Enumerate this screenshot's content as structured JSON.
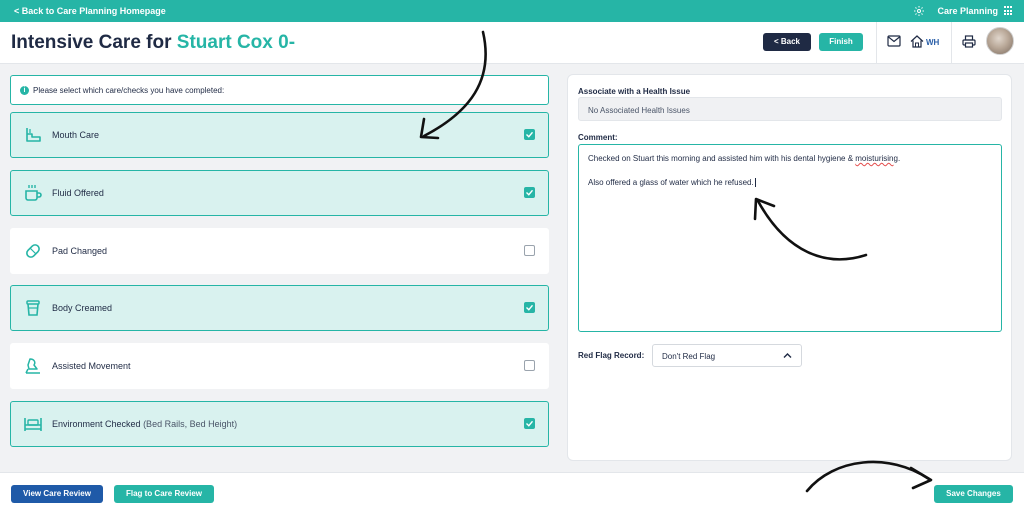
{
  "topbar": {
    "back_link": "< Back to Care Planning Homepage",
    "app_name": "Care Planning",
    "icons": {
      "settings": "gear-icon",
      "apps": "grid-icon"
    }
  },
  "header": {
    "title_prefix": "Intensive Care for",
    "title_name": "Stuart Cox 0-",
    "back_button": "< Back",
    "finish_button": "Finish",
    "home_label": "WH",
    "icons": {
      "mail": "mail-icon",
      "home": "home-icon",
      "print": "printer-icon",
      "avatar": "avatar"
    }
  },
  "checklist": {
    "instruction": "Please select which care/checks you have completed:",
    "items": [
      {
        "label": "Mouth Care",
        "extra": "",
        "checked": true,
        "icon": "toothbrush-icon"
      },
      {
        "label": "Fluid Offered",
        "extra": "",
        "checked": true,
        "icon": "cup-icon"
      },
      {
        "label": "Pad Changed",
        "extra": "",
        "checked": false,
        "icon": "pad-icon"
      },
      {
        "label": "Body Creamed",
        "extra": "",
        "checked": true,
        "icon": "cream-jar-icon"
      },
      {
        "label": "Assisted Movement",
        "extra": "",
        "checked": false,
        "icon": "walking-assist-icon"
      },
      {
        "label": "Environment Checked",
        "extra": "(Bed Rails, Bed Height)",
        "checked": true,
        "icon": "bed-icon"
      }
    ]
  },
  "details": {
    "health_label": "Associate with a Health Issue",
    "health_value": "No Associated Health Issues",
    "comment_label": "Comment:",
    "comment_line1_pre": "Checked on Stuart this morning and assisted him with his dental hygiene & ",
    "comment_line1_misspelled": "moisturising",
    "comment_line1_post": ".",
    "comment_line2": "Also offered a glass of water which he refused.",
    "redflag_label": "Red Flag Record:",
    "redflag_value": "Don't Red Flag"
  },
  "footer": {
    "view_review": "View Care Review",
    "flag_review": "Flag to Care Review",
    "save": "Save Changes"
  },
  "colors": {
    "accent": "#26b5a6",
    "navy": "#1f2a44",
    "blue": "#1f5aa8",
    "checked_bg": "#d9f2ef"
  }
}
